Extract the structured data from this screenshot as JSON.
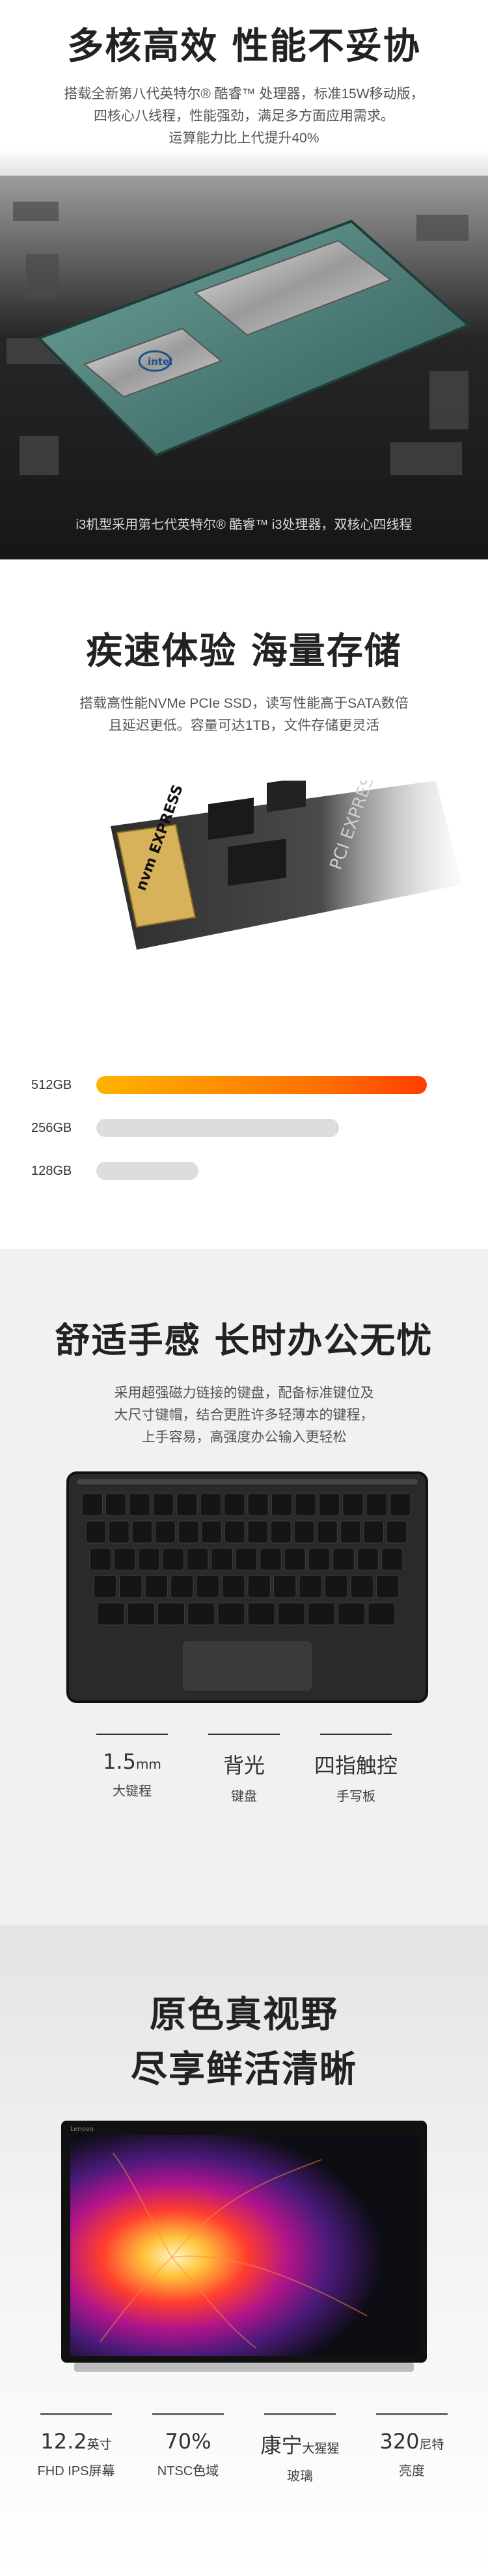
{
  "cpu": {
    "title": "多核高效 性能不妥协",
    "desc_lines": [
      "搭载全新第八代英特尔® 酷睿™ 处理器，标准15W移动版，",
      "四核心八线程，性能强劲，满足多方面应用需求。",
      "运算能力比上代提升40%"
    ],
    "caption": "i3机型采用第七代英特尔® 酷睿™ i3处理器，双核心四线程",
    "chip_logo": "intel"
  },
  "ssd": {
    "title": "疾速体验 海量存储",
    "desc_lines": [
      "搭载高性能NVMe PCIe SSD，读写性能高于SATA数倍",
      "且延迟更低。容量可达1TB，文件存储更灵活"
    ],
    "module_brand": "nvm EXPRESS",
    "module_text": "PCI EXPRESS",
    "capacities": [
      {
        "label": "512GB",
        "level": 0.94,
        "style": "fast"
      },
      {
        "label": "256GB",
        "level": 0.69,
        "style": "slow"
      },
      {
        "label": "128GB",
        "level": 0.29,
        "style": "slow"
      }
    ],
    "accent": "#ff6d00"
  },
  "keyboard": {
    "title": "舒适手感 长时办公无忧",
    "desc_lines": [
      "采用超强磁力链接的键盘，配备标准键位及",
      "大尺寸键帽，结合更胜许多轻薄本的键程，",
      "上手容易，高强度办公输入更轻松"
    ],
    "specs": [
      {
        "value": "1.5",
        "unit": "mm",
        "label": "大键程"
      },
      {
        "value": "背光",
        "unit": "",
        "label": "键盘"
      },
      {
        "value": "四指触控",
        "unit": "",
        "label": "手写板"
      }
    ]
  },
  "display": {
    "title_line1": "原色真视野",
    "title_line2": "尽享鲜活清晰",
    "bezel_brand": "Lenovo",
    "specs": [
      {
        "value": "12.2",
        "unit": "英寸",
        "label": "FHD IPS屏幕"
      },
      {
        "value": "70%",
        "unit": "",
        "label": "NTSC色域"
      },
      {
        "value": "康宁",
        "unit": "大猩猩",
        "label": "玻璃"
      },
      {
        "value": "320",
        "unit": "尼特",
        "label": "亮度"
      }
    ]
  }
}
